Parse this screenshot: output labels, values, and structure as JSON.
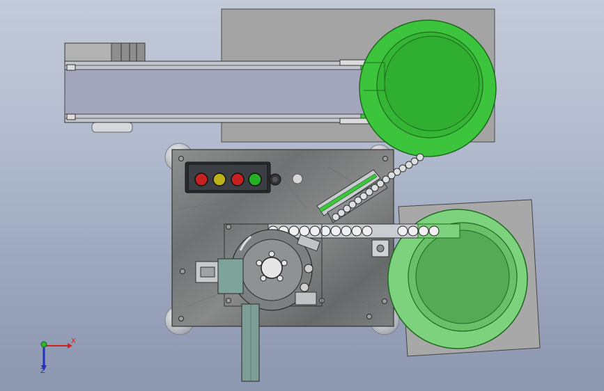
{
  "viewport": {
    "background": "#b3bccf",
    "triad": {
      "x_label": "X",
      "z_label": "Z"
    }
  },
  "machine": {
    "bowl_color": "#3cc53c",
    "bowl_inner_color": "#2fa82f",
    "frame_color": "#7b7f83",
    "plate_color": "#a3a3a3",
    "indicator_lights": [
      "#c62020",
      "#b9b21a",
      "#c62020",
      "#25b025"
    ]
  }
}
